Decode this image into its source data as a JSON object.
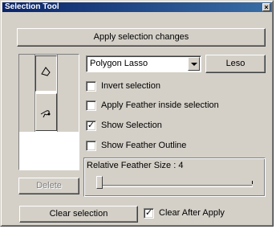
{
  "window": {
    "title": "Selection Tool",
    "close_glyph": "×"
  },
  "buttons": {
    "apply": "Apply selection changes",
    "lasso": "Leso",
    "delete": "Delete",
    "clear": "Clear selection"
  },
  "tools": [
    {
      "name": "polygon-lasso",
      "icon": "polygon-lasso-icon",
      "selected": true
    },
    {
      "name": "freehand-lasso",
      "icon": "freehand-lasso-icon",
      "selected": false
    }
  ],
  "mode_select": {
    "value": "Polygon Lasso"
  },
  "options": [
    {
      "label": "Invert selection",
      "checked": false
    },
    {
      "label": "Apply Feather inside selection",
      "checked": false
    },
    {
      "label": "Show Selection",
      "checked": true
    },
    {
      "label": "Show Feather Outline",
      "checked": false
    }
  ],
  "feather": {
    "label": "Relative Feather Size : 4",
    "value": 4
  },
  "clear_after_apply": {
    "label": "Clear After Apply",
    "checked": true
  }
}
